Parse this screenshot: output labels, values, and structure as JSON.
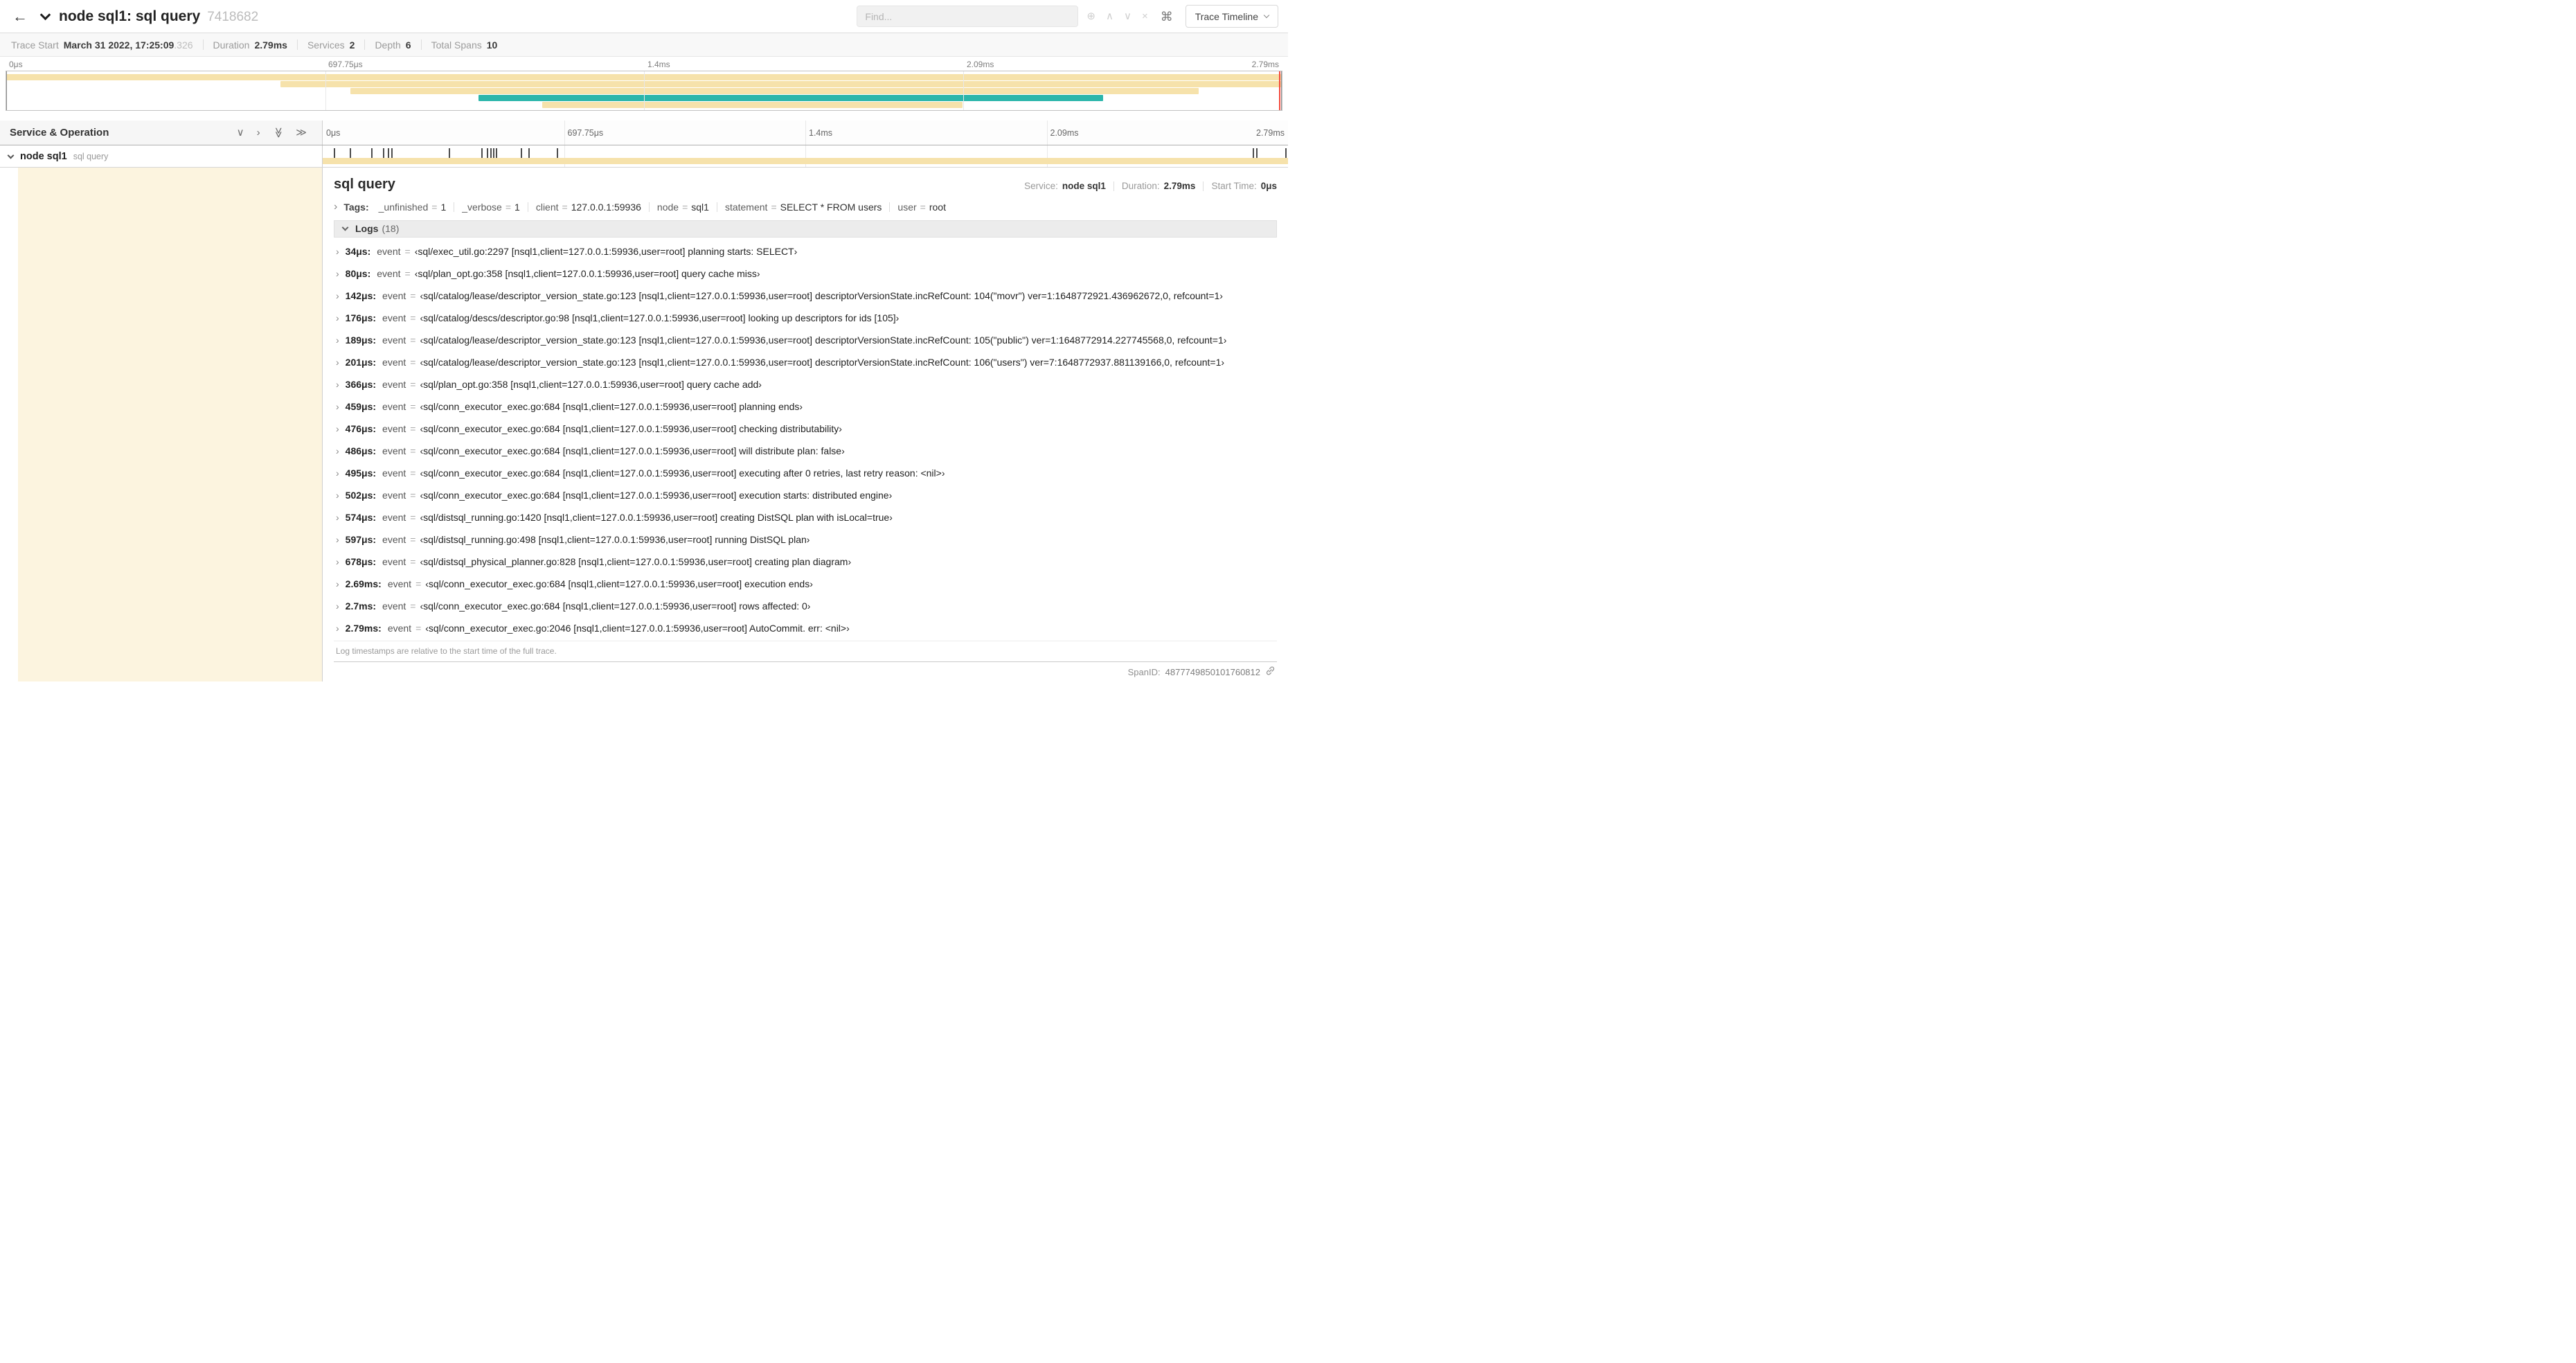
{
  "header": {
    "title": "node sql1: sql query",
    "trace_id": "7418682",
    "find_placeholder": "Find...",
    "trace_timeline_label": "Trace Timeline",
    "find_controls": [
      {
        "name": "focus-match-icon",
        "glyph": "⊕"
      },
      {
        "name": "prev-match-icon",
        "glyph": "∧"
      },
      {
        "name": "next-match-icon",
        "glyph": "∨"
      },
      {
        "name": "clear-match-icon",
        "glyph": "×"
      }
    ]
  },
  "summary": {
    "items": [
      {
        "label": "Trace Start",
        "value": "March 31 2022, 17:25:09",
        "suffix": ".326"
      },
      {
        "label": "Duration",
        "value": "2.79ms"
      },
      {
        "label": "Services",
        "value": "2"
      },
      {
        "label": "Depth",
        "value": "6"
      },
      {
        "label": "Total Spans",
        "value": "10"
      }
    ]
  },
  "colors": {
    "tan": "#f6e2ab",
    "teal": "#2bb6ab",
    "cream": "#fcf4df",
    "red": "#f4493c"
  },
  "minimap": {
    "ticks": [
      "0μs",
      "697.75μs",
      "1.4ms",
      "2.09ms",
      "2.79ms"
    ],
    "bars": [
      {
        "start": 0,
        "end": 100,
        "color": "tan"
      },
      {
        "start": 21.5,
        "end": 100,
        "color": "tan"
      },
      {
        "start": 27,
        "end": 93.5,
        "color": "tan"
      },
      {
        "start": 37,
        "end": 86,
        "color": "teal"
      },
      {
        "start": 42,
        "end": 75,
        "color": "tan"
      }
    ]
  },
  "timeline": {
    "left_header": "Service & Operation",
    "ticks": [
      "0μs",
      "697.75μs",
      "1.4ms",
      "2.09ms",
      "2.79ms"
    ],
    "controls": [
      {
        "name": "collapse-one-icon",
        "glyph": "∨"
      },
      {
        "name": "expand-one-icon",
        "glyph": "›"
      },
      {
        "name": "collapse-all-icon",
        "glyph": "≫"
      },
      {
        "name": "expand-all-icon",
        "glyph": "≫"
      }
    ]
  },
  "span_row": {
    "service": "node sql1",
    "operation": "sql query",
    "log_marker_positions_pct": [
      1.2,
      2.9,
      5.1,
      6.3,
      6.8,
      7.2,
      13.1,
      16.5,
      17.1,
      17.4,
      17.7,
      18.0,
      20.6,
      21.4,
      24.3,
      96.4,
      96.8,
      99.8
    ]
  },
  "detail": {
    "operation": "sql query",
    "meta": [
      {
        "label": "Service:",
        "value": "node sql1"
      },
      {
        "label": "Duration:",
        "value": "2.79ms"
      },
      {
        "label": "Start Time:",
        "value": "0μs"
      }
    ],
    "tags_label": "Tags:",
    "tags": [
      {
        "key": "_unfinished",
        "value": "1"
      },
      {
        "key": "_verbose",
        "value": "1"
      },
      {
        "key": "client",
        "value": "127.0.0.1:59936"
      },
      {
        "key": "node",
        "value": "sql1"
      },
      {
        "key": "statement",
        "value": "SELECT * FROM users"
      },
      {
        "key": "user",
        "value": "root"
      }
    ],
    "logs_label": "Logs",
    "logs_count": "(18)",
    "logs": [
      {
        "time": "34μs:",
        "key": "event",
        "value": "‹sql/exec_util.go:2297 [nsql1,client=127.0.0.1:59936,user=root] planning starts: SELECT›"
      },
      {
        "time": "80μs:",
        "key": "event",
        "value": "‹sql/plan_opt.go:358 [nsql1,client=127.0.0.1:59936,user=root] query cache miss›"
      },
      {
        "time": "142μs:",
        "key": "event",
        "value": "‹sql/catalog/lease/descriptor_version_state.go:123 [nsql1,client=127.0.0.1:59936,user=root] descriptorVersionState.incRefCount: 104(\"movr\") ver=1:1648772921.436962672,0, refcount=1›"
      },
      {
        "time": "176μs:",
        "key": "event",
        "value": "‹sql/catalog/descs/descriptor.go:98 [nsql1,client=127.0.0.1:59936,user=root] looking up descriptors for ids [105]›"
      },
      {
        "time": "189μs:",
        "key": "event",
        "value": "‹sql/catalog/lease/descriptor_version_state.go:123 [nsql1,client=127.0.0.1:59936,user=root] descriptorVersionState.incRefCount: 105(\"public\") ver=1:1648772914.227745568,0, refcount=1›"
      },
      {
        "time": "201μs:",
        "key": "event",
        "value": "‹sql/catalog/lease/descriptor_version_state.go:123 [nsql1,client=127.0.0.1:59936,user=root] descriptorVersionState.incRefCount: 106(\"users\") ver=7:1648772937.881139166,0, refcount=1›"
      },
      {
        "time": "366μs:",
        "key": "event",
        "value": "‹sql/plan_opt.go:358 [nsql1,client=127.0.0.1:59936,user=root] query cache add›"
      },
      {
        "time": "459μs:",
        "key": "event",
        "value": "‹sql/conn_executor_exec.go:684 [nsql1,client=127.0.0.1:59936,user=root] planning ends›"
      },
      {
        "time": "476μs:",
        "key": "event",
        "value": "‹sql/conn_executor_exec.go:684 [nsql1,client=127.0.0.1:59936,user=root] checking distributability›"
      },
      {
        "time": "486μs:",
        "key": "event",
        "value": "‹sql/conn_executor_exec.go:684 [nsql1,client=127.0.0.1:59936,user=root] will distribute plan: false›"
      },
      {
        "time": "495μs:",
        "key": "event",
        "value": "‹sql/conn_executor_exec.go:684 [nsql1,client=127.0.0.1:59936,user=root] executing after 0 retries, last retry reason: <nil>›"
      },
      {
        "time": "502μs:",
        "key": "event",
        "value": "‹sql/conn_executor_exec.go:684 [nsql1,client=127.0.0.1:59936,user=root] execution starts: distributed engine›"
      },
      {
        "time": "574μs:",
        "key": "event",
        "value": "‹sql/distsql_running.go:1420 [nsql1,client=127.0.0.1:59936,user=root] creating DistSQL plan with isLocal=true›"
      },
      {
        "time": "597μs:",
        "key": "event",
        "value": "‹sql/distsql_running.go:498 [nsql1,client=127.0.0.1:59936,user=root] running DistSQL plan›"
      },
      {
        "time": "678μs:",
        "key": "event",
        "value": "‹sql/distsql_physical_planner.go:828 [nsql1,client=127.0.0.1:59936,user=root] creating plan diagram›"
      },
      {
        "time": "2.69ms:",
        "key": "event",
        "value": "‹sql/conn_executor_exec.go:684 [nsql1,client=127.0.0.1:59936,user=root] execution ends›"
      },
      {
        "time": "2.7ms:",
        "key": "event",
        "value": "‹sql/conn_executor_exec.go:684 [nsql1,client=127.0.0.1:59936,user=root] rows affected: 0›"
      },
      {
        "time": "2.79ms:",
        "key": "event",
        "value": "‹sql/conn_executor_exec.go:2046 [nsql1,client=127.0.0.1:59936,user=root] AutoCommit. err: <nil>›"
      }
    ],
    "footnote": "Log timestamps are relative to the start time of the full trace.",
    "span_id_label": "SpanID:",
    "span_id": "4877749850101760812"
  }
}
